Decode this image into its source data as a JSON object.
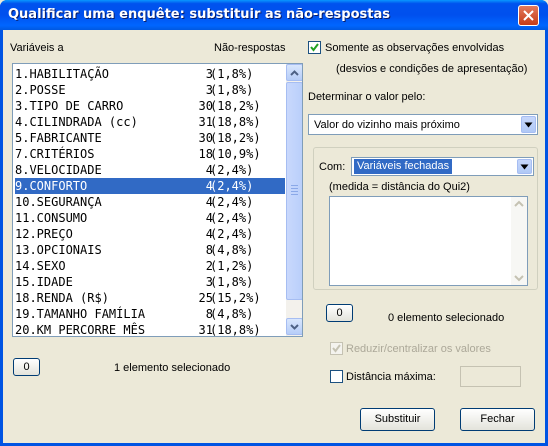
{
  "window": {
    "title": "Qualificar uma enquête: substituir as não-respostas"
  },
  "left": {
    "vars_header": "Variáveis a",
    "nr_header": "Não-respostas",
    "items": [
      {
        "label": "1.HABILITAÇÃO",
        "count": "3",
        "pct": "(1,8%)"
      },
      {
        "label": "2.POSSE",
        "count": "3",
        "pct": "(1,8%)"
      },
      {
        "label": "3.TIPO DE CARRO",
        "count": "30",
        "pct": "(18,2%)"
      },
      {
        "label": "4.CILINDRADA (cc)",
        "count": "31",
        "pct": "(18,8%)"
      },
      {
        "label": "5.FABRICANTE",
        "count": "30",
        "pct": "(18,2%)"
      },
      {
        "label": "7.CRITÉRIOS",
        "count": "18",
        "pct": "(10,9%)"
      },
      {
        "label": "8.VELOCIDADE",
        "count": "4",
        "pct": "(2,4%)"
      },
      {
        "label": "9.CONFORTO",
        "count": "4",
        "pct": "(2,4%)"
      },
      {
        "label": "10.SEGURANÇA",
        "count": "4",
        "pct": "(2,4%)"
      },
      {
        "label": "11.CONSUMO",
        "count": "4",
        "pct": "(2,4%)"
      },
      {
        "label": "12.PREÇO",
        "count": "4",
        "pct": "(2,4%)"
      },
      {
        "label": "13.OPCIONAIS",
        "count": "8",
        "pct": "(4,8%)"
      },
      {
        "label": "14.SEXO",
        "count": "2",
        "pct": "(1,2%)"
      },
      {
        "label": "15.IDADE",
        "count": "3",
        "pct": "(1,8%)"
      },
      {
        "label": "18.RENDA (R$)",
        "count": "25",
        "pct": "(15,2%)"
      },
      {
        "label": "19.TAMANHO FAMÍLIA",
        "count": "8",
        "pct": "(4,8%)"
      },
      {
        "label": "20.KM PERCORRE MÊS",
        "count": "31",
        "pct": "(18,8%)"
      }
    ],
    "selected_index": 7,
    "count_button": "0",
    "selected_text": "1 elemento selecionado"
  },
  "right": {
    "only_obs_label": "Somente as observações envolvidas",
    "only_obs_sub": "(desvios e condições de apresentação)",
    "determine_label": "Determinar o valor pelo:",
    "method_value": "Valor do vizinho mais próximo",
    "com_label": "Com:",
    "com_value": "Variáveis fechadas",
    "measure_note": "(medida = distância do Qui2)",
    "count_button": "0",
    "selected_text": "0 elemento selecionado",
    "reduce_label": "Reduzir/centralizar os valores",
    "maxdist_label": "Distância máxima:",
    "maxdist_value": ""
  },
  "buttons": {
    "substitute": "Substituir",
    "close": "Fechar"
  }
}
